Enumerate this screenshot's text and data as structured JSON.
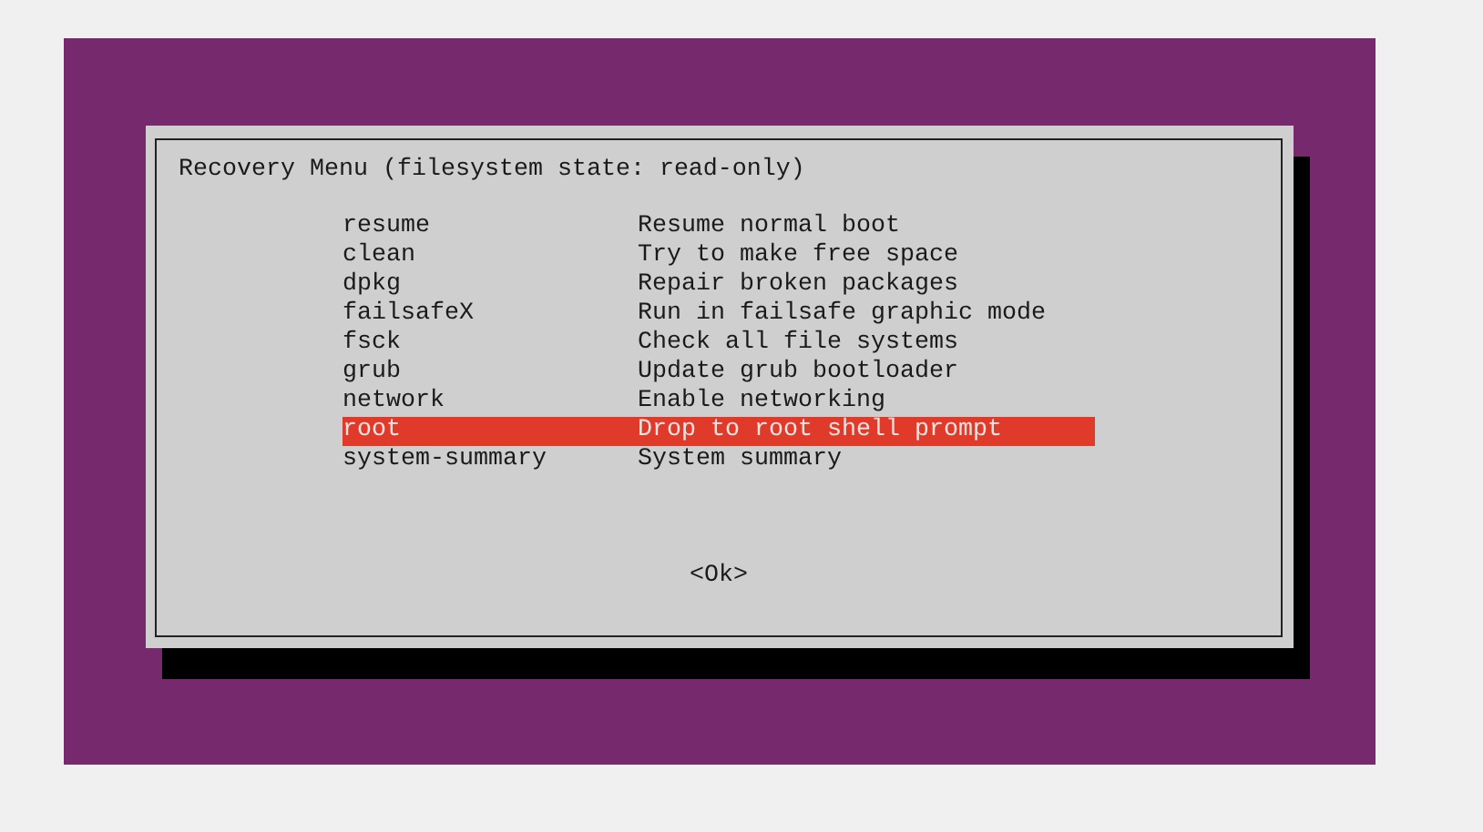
{
  "dialog": {
    "title": "Recovery Menu (filesystem state: read-only)",
    "items": [
      {
        "name": "resume",
        "description": "Resume normal boot",
        "selected": false
      },
      {
        "name": "clean",
        "description": "Try to make free space",
        "selected": false
      },
      {
        "name": "dpkg",
        "description": "Repair broken packages",
        "selected": false
      },
      {
        "name": "failsafeX",
        "description": "Run in failsafe graphic mode",
        "selected": false
      },
      {
        "name": "fsck",
        "description": "Check all file systems",
        "selected": false
      },
      {
        "name": "grub",
        "description": "Update grub bootloader",
        "selected": false
      },
      {
        "name": "network",
        "description": "Enable networking",
        "selected": false
      },
      {
        "name": "root",
        "description": "Drop to root shell prompt",
        "selected": true
      },
      {
        "name": "system-summary",
        "description": "System summary",
        "selected": false
      }
    ],
    "button": "<Ok>"
  }
}
